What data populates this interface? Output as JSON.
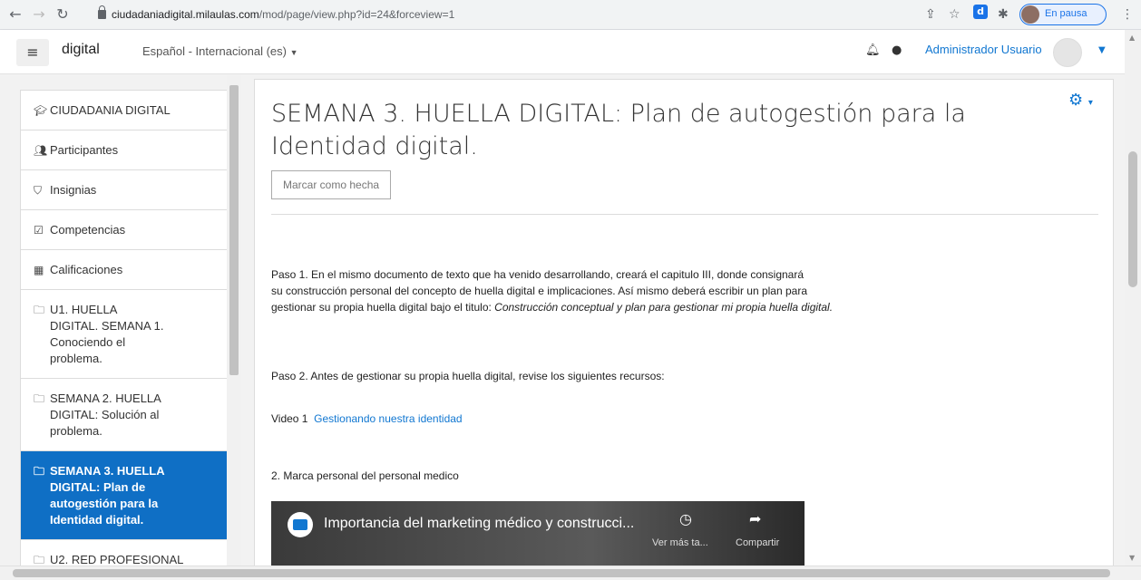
{
  "browser": {
    "url_host": "ciudadaniadigital.milaulas.com",
    "url_path": "/mod/page/view.php?id=24&forceview=1",
    "pause_label": "En pausa"
  },
  "navbar": {
    "brand": "digital",
    "language": "Español - Internacional (es)",
    "user_name": "Administrador Usuario"
  },
  "drawer": {
    "items": [
      {
        "icon": "graduation-cap-icon",
        "label": "CIUDADANIA DIGITAL"
      },
      {
        "icon": "users-icon",
        "label": "Participantes"
      },
      {
        "icon": "shield-icon",
        "label": "Insignias"
      },
      {
        "icon": "checkbox-icon",
        "label": "Competencias"
      },
      {
        "icon": "table-icon",
        "label": "Calificaciones"
      },
      {
        "icon": "folder-icon",
        "label": "U1. HUELLA DIGITAL. SEMANA 1. Conociendo el problema."
      },
      {
        "icon": "folder-icon",
        "label": "SEMANA 2. HUELLA DIGITAL: Solución al problema."
      },
      {
        "icon": "folder-icon",
        "label": "SEMANA 3. HUELLA DIGITAL: Plan de autogestión para la Identidad digital."
      },
      {
        "icon": "folder-icon",
        "label": "U2. RED PROFESIONAL"
      }
    ]
  },
  "main": {
    "title": "SEMANA 3. HUELLA DIGITAL: Plan de autogestión para la Identidad digital.",
    "mark_done": "Marcar como hecha",
    "para1_line1": "Paso 1. En el mismo documento de texto que ha venido desarrollando, creará el capitulo III, donde consignará",
    "para1_line2": "su construcción personal del concepto de huella digital e implicaciones. Así mismo deberá escribir un plan para",
    "para1_line3": "gestionar su propia huella digital bajo el titulo: ",
    "para1_italic": "Construcción conceptual y plan para gestionar mi propia huella digital.",
    "para2": "Paso 2. Antes de gestionar su propia huella digital, revise los siguientes recursos:",
    "video_label": "Video 1",
    "video_link": "Gestionando nuestra identidad",
    "para3": "2. Marca personal del personal medico",
    "video_title": "Importancia del marketing médico y construcci...",
    "watch_later": "Ver más ta...",
    "share": "Compartir"
  },
  "colors": {
    "accent": "#1177d1",
    "active_bg": "#0f6fc5"
  }
}
